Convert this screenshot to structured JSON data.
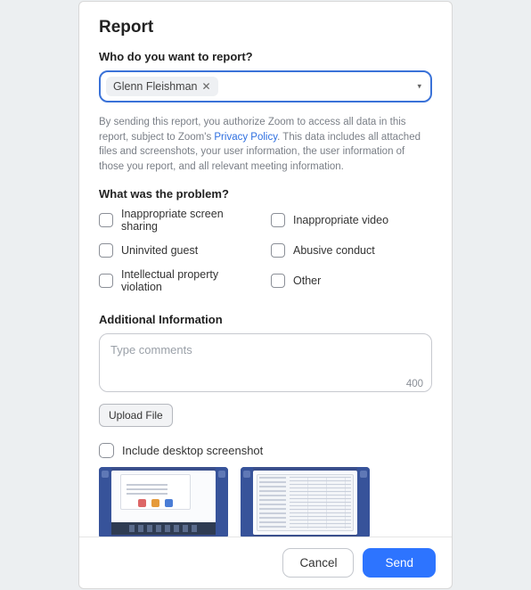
{
  "title": "Report",
  "who": {
    "label": "Who do you want to report?",
    "chip_name": "Glenn Fleishman"
  },
  "disclosure": {
    "prefix": "By sending this report, you authorize Zoom to access all data in this report, subject to Zoom's ",
    "link": "Privacy Policy",
    "suffix": ". This data includes all attached files and screenshots, your user information, the user information of those you report, and all relevant meeting information."
  },
  "problem": {
    "label": "What was the problem?",
    "options": [
      "Inappropriate screen sharing",
      "Inappropriate video",
      "Uninvited guest",
      "Abusive conduct",
      "Intellectual property violation",
      "Other"
    ]
  },
  "additional": {
    "label": "Additional Information",
    "placeholder": "Type comments",
    "char_limit": "400",
    "upload_label": "Upload File",
    "include_label": "Include desktop screenshot"
  },
  "footer": {
    "cancel": "Cancel",
    "send": "Send"
  }
}
